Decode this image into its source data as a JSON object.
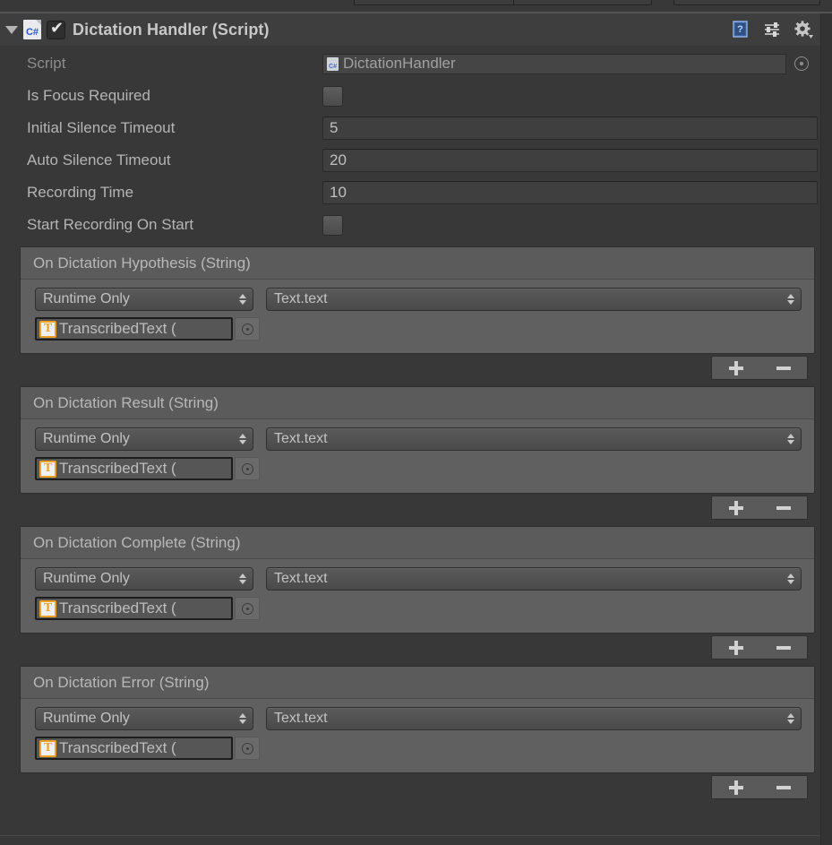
{
  "component": {
    "title": "Dictation Handler (Script)",
    "enabled": true,
    "expanded": true,
    "script_badge_label": "C#",
    "checkmark": "✔",
    "icons": {
      "foldout": "triangle-down-icon",
      "help": "help-book-icon",
      "preset": "preset-sliders-icon",
      "settings": "gear-icon"
    }
  },
  "properties": {
    "script": {
      "label": "Script",
      "value": "DictationHandler",
      "badge": "C#"
    },
    "is_focus_required": {
      "label": "Is Focus Required",
      "value": false
    },
    "initial_silence_timeout": {
      "label": "Initial Silence Timeout",
      "value": "5"
    },
    "auto_silence_timeout": {
      "label": "Auto Silence Timeout",
      "value": "20"
    },
    "recording_time": {
      "label": "Recording Time",
      "value": "10"
    },
    "start_recording_on_start": {
      "label": "Start Recording On Start",
      "value": false
    }
  },
  "events": [
    {
      "header": "On Dictation Hypothesis (String)",
      "mode": "Runtime Only",
      "function": "Text.text",
      "target": "TranscribedText (",
      "target_badge": "T",
      "add_label": "+",
      "remove_label": "−"
    },
    {
      "header": "On Dictation Result (String)",
      "mode": "Runtime Only",
      "function": "Text.text",
      "target": "TranscribedText (",
      "target_badge": "T",
      "add_label": "+",
      "remove_label": "−"
    },
    {
      "header": "On Dictation Complete (String)",
      "mode": "Runtime Only",
      "function": "Text.text",
      "target": "TranscribedText (",
      "target_badge": "T",
      "add_label": "+",
      "remove_label": "−"
    },
    {
      "header": "On Dictation Error (String)",
      "mode": "Runtime Only",
      "function": "Text.text",
      "target": "TranscribedText (",
      "target_badge": "T",
      "add_label": "+",
      "remove_label": "−"
    }
  ],
  "colors": {
    "panel_bg": "#383838",
    "header_bg": "#3e3e3e",
    "event_bg": "#606060",
    "event_header_bg": "#5b5b5b",
    "text": "#b4b4b4",
    "text_dim": "#8c8c8c",
    "accent_orange": "#f0a020",
    "accent_blue": "#2a56c6"
  }
}
